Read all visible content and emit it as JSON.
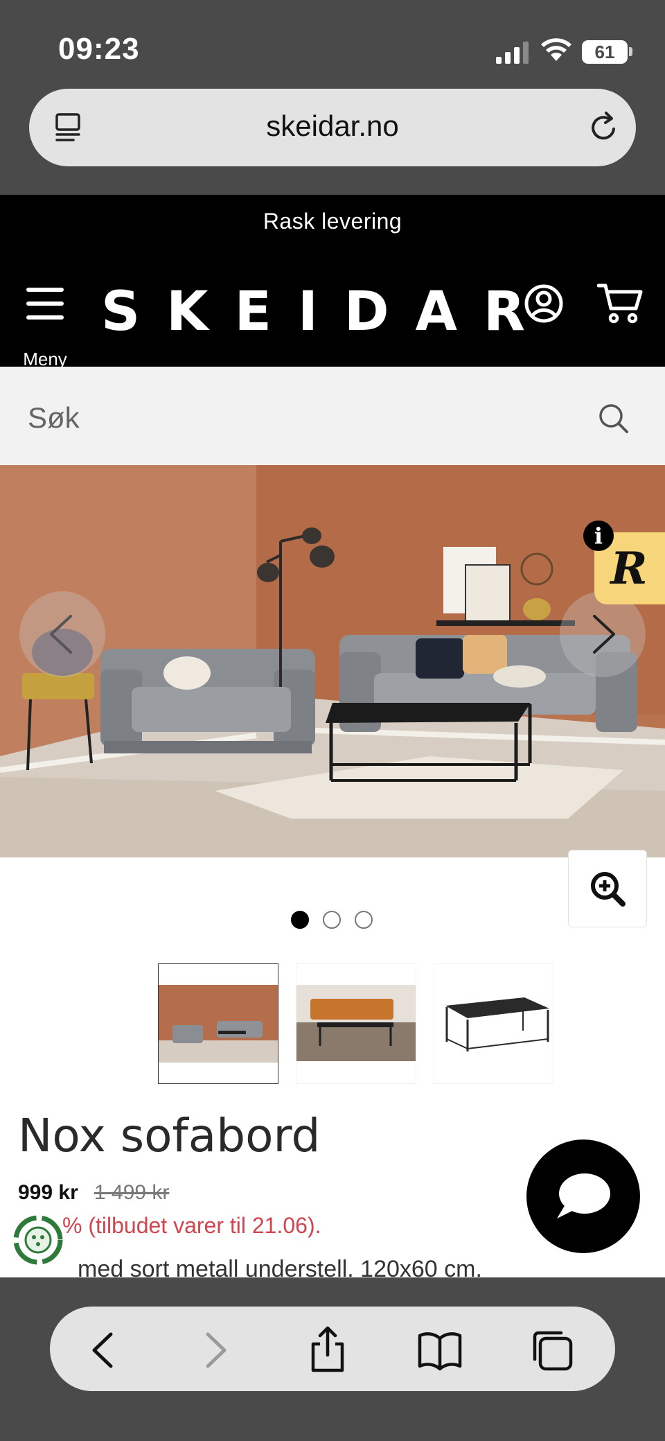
{
  "status_bar": {
    "time": "09:23",
    "battery": "61"
  },
  "browser": {
    "url": "skeidar.no"
  },
  "promo": {
    "text": "Rask levering"
  },
  "header": {
    "logo": "SKEIDAR",
    "menu_label": "Meny"
  },
  "search": {
    "placeholder": "Søk"
  },
  "carousel": {
    "total_slides": 3,
    "active_slide": 1
  },
  "product": {
    "title": "Nox sofabord",
    "price": "999 kr",
    "old_price": "1 499 kr",
    "offer_text": "% (tilbudet varer til 21.06).",
    "description": "med sort metall understell. 120x60 cm."
  },
  "colors": {
    "brand_black": "#000000",
    "offer_red": "#d0454f",
    "badge_yellow": "#f7d57a"
  }
}
